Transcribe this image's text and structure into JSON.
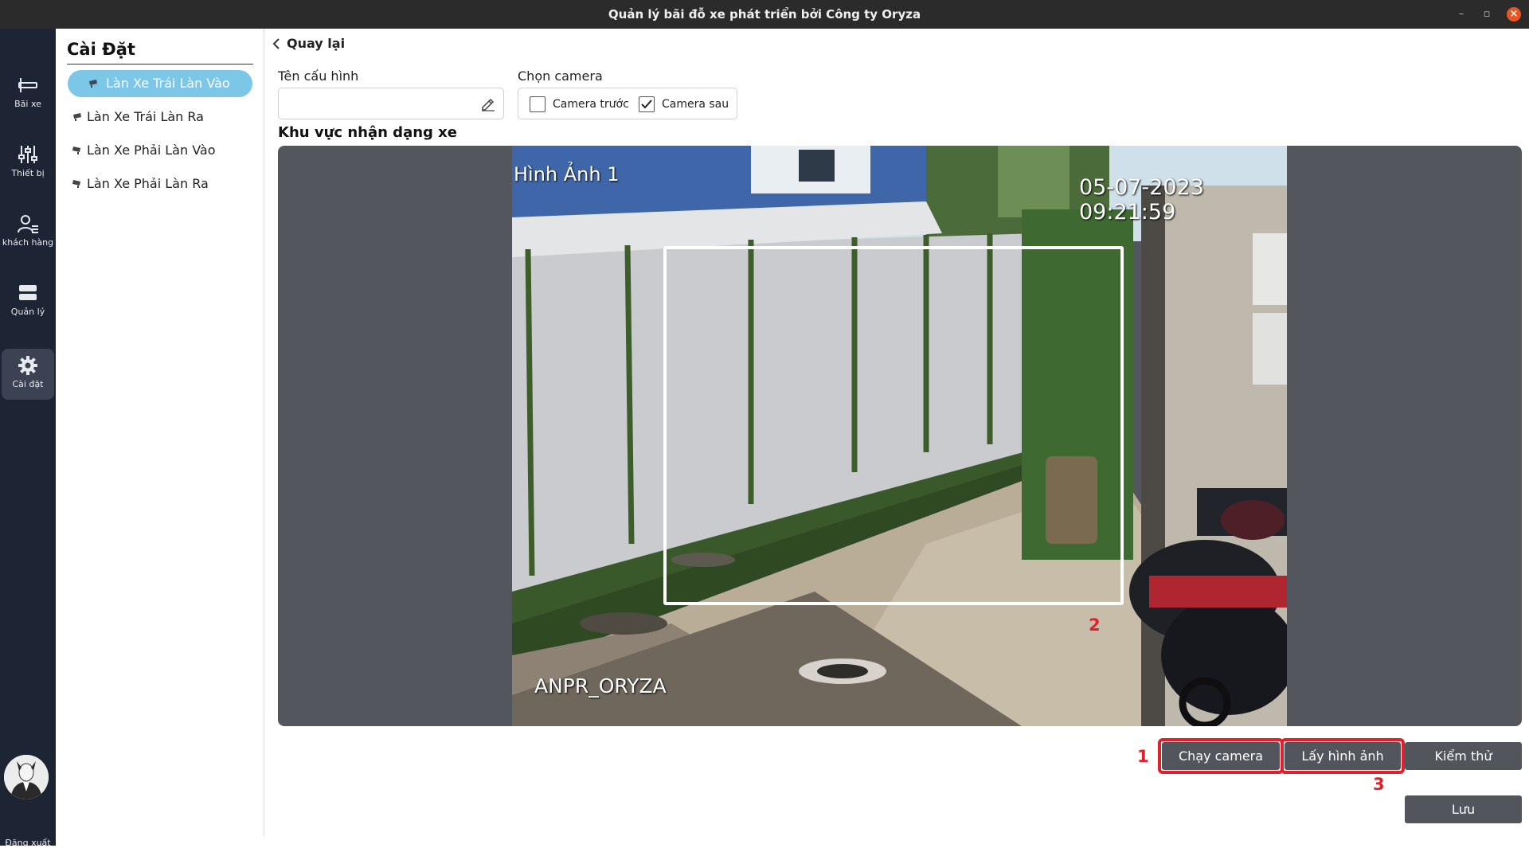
{
  "window": {
    "title": "Quản lý bãi đỗ xe phát triển bởi Công ty Oryza"
  },
  "nav": {
    "items": [
      {
        "label": "Bãi xe",
        "icon": "parking-icon"
      },
      {
        "label": "Thiết bị",
        "icon": "sliders-icon"
      },
      {
        "label": "khách hàng",
        "icon": "user-list-icon"
      },
      {
        "label": "Quản lý",
        "icon": "database-icon"
      },
      {
        "label": "Cài đặt",
        "icon": "gear-icon",
        "active": true
      }
    ],
    "logout_label": "Đăng xuất"
  },
  "settings_panel": {
    "title": "Cài Đặt",
    "lanes": [
      {
        "label": "Làn Xe Trái Làn Vào",
        "active": true
      },
      {
        "label": "Làn Xe Trái Làn Ra"
      },
      {
        "label": "Làn Xe Phải Làn Vào"
      },
      {
        "label": "Làn Xe Phải Làn Ra"
      }
    ]
  },
  "main": {
    "back_label": "Quay lại",
    "config_name": {
      "label": "Tên cấu hình",
      "value": ""
    },
    "camera_select": {
      "label": "Chọn camera",
      "options": [
        {
          "label": "Camera trước",
          "checked": false
        },
        {
          "label": "Camera sau",
          "checked": true
        }
      ]
    },
    "region_title": "Khu vực nhận dạng xe",
    "camera_feed": {
      "overlay_top_left": "Hình Ảnh 1",
      "overlay_timestamp": "05-07-2023 09:21:59",
      "overlay_bottom_left": "ANPR_ORYZA"
    },
    "buttons": {
      "run_camera": "Chạy camera",
      "capture_image": "Lấy hình ảnh",
      "test": "Kiểm thử",
      "save": "Lưu"
    },
    "annotations": {
      "step1": "1",
      "step2": "2",
      "step3": "3"
    }
  },
  "colors": {
    "nav_bg": "#1d2433",
    "active_lane": "#7cc6e8",
    "button_bg": "#52555c",
    "highlight": "#e0202a"
  }
}
